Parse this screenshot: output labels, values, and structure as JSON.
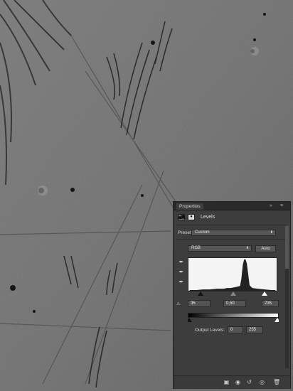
{
  "panel": {
    "title": "Properties",
    "header_buttons": [
      "▸▸",
      "≡"
    ],
    "adjustment_name": "Levels",
    "preset_label": "Preset:",
    "preset_value": "Custom",
    "channel_value": "RGB",
    "auto_label": "Auto",
    "input_black": "35",
    "input_gamma": "0,50",
    "input_white": "235",
    "output_label": "Output Levels:",
    "output_black": "0",
    "output_white": "255"
  },
  "colors": {
    "panel_bg": "#3d3d3d",
    "histogram_bg": "#f4f4f4",
    "canvas_gray": "#6a6a6a"
  },
  "icons": {
    "header_adjust": "levels-icon",
    "header_mask": "mask-icon",
    "eyedropper_black": "eyedropper-black-icon",
    "eyedropper_gray": "eyedropper-gray-icon",
    "eyedropper_white": "eyedropper-white-icon",
    "clip_warning": "clip-icon",
    "bottom": [
      "clip-to-layer-icon",
      "view-previous-icon",
      "reset-icon",
      "visibility-icon",
      "trash-icon"
    ]
  }
}
